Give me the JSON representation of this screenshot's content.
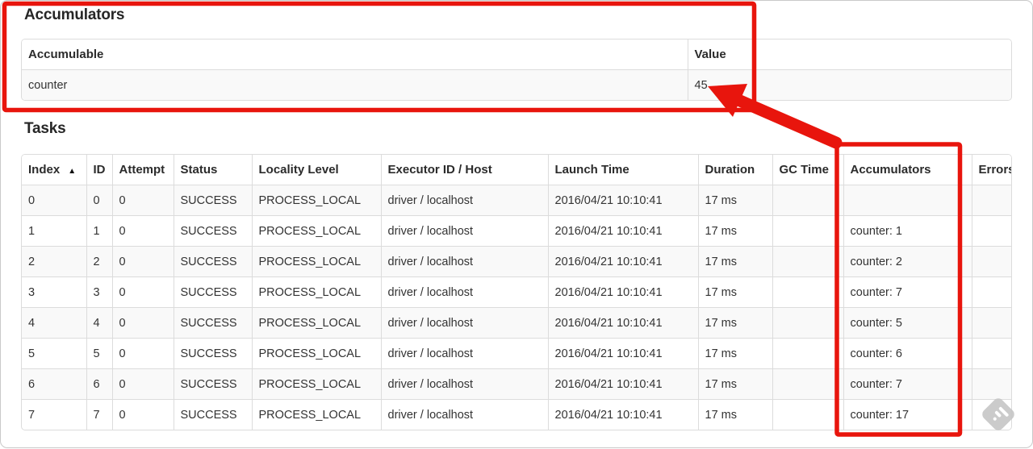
{
  "accumulators_section": {
    "title": "Accumulators",
    "table": {
      "col_accumulable": "Accumulable",
      "col_value": "Value",
      "row": {
        "accumulable": "counter",
        "value": "45"
      }
    }
  },
  "tasks_section": {
    "title": "Tasks",
    "table": {
      "headers": [
        "Index",
        "ID",
        "Attempt",
        "Status",
        "Locality Level",
        "Executor ID / Host",
        "Launch Time",
        "Duration",
        "GC Time",
        "Accumulators",
        "Errors"
      ],
      "sort_icon": "▲",
      "rows": [
        {
          "index": "0",
          "id": "0",
          "attempt": "0",
          "status": "SUCCESS",
          "locality_level": "PROCESS_LOCAL",
          "executor_id_host": "driver / localhost",
          "launch_time": "2016/04/21 10:10:41",
          "duration": "17 ms",
          "gc_time": "",
          "accumulators": "",
          "errors": ""
        },
        {
          "index": "1",
          "id": "1",
          "attempt": "0",
          "status": "SUCCESS",
          "locality_level": "PROCESS_LOCAL",
          "executor_id_host": "driver / localhost",
          "launch_time": "2016/04/21 10:10:41",
          "duration": "17 ms",
          "gc_time": "",
          "accumulators": "counter: 1",
          "errors": ""
        },
        {
          "index": "2",
          "id": "2",
          "attempt": "0",
          "status": "SUCCESS",
          "locality_level": "PROCESS_LOCAL",
          "executor_id_host": "driver / localhost",
          "launch_time": "2016/04/21 10:10:41",
          "duration": "17 ms",
          "gc_time": "",
          "accumulators": "counter: 2",
          "errors": ""
        },
        {
          "index": "3",
          "id": "3",
          "attempt": "0",
          "status": "SUCCESS",
          "locality_level": "PROCESS_LOCAL",
          "executor_id_host": "driver / localhost",
          "launch_time": "2016/04/21 10:10:41",
          "duration": "17 ms",
          "gc_time": "",
          "accumulators": "counter: 7",
          "errors": ""
        },
        {
          "index": "4",
          "id": "4",
          "attempt": "0",
          "status": "SUCCESS",
          "locality_level": "PROCESS_LOCAL",
          "executor_id_host": "driver / localhost",
          "launch_time": "2016/04/21 10:10:41",
          "duration": "17 ms",
          "gc_time": "",
          "accumulators": "counter: 5",
          "errors": ""
        },
        {
          "index": "5",
          "id": "5",
          "attempt": "0",
          "status": "SUCCESS",
          "locality_level": "PROCESS_LOCAL",
          "executor_id_host": "driver / localhost",
          "launch_time": "2016/04/21 10:10:41",
          "duration": "17 ms",
          "gc_time": "",
          "accumulators": "counter: 6",
          "errors": ""
        },
        {
          "index": "6",
          "id": "6",
          "attempt": "0",
          "status": "SUCCESS",
          "locality_level": "PROCESS_LOCAL",
          "executor_id_host": "driver / localhost",
          "launch_time": "2016/04/21 10:10:41",
          "duration": "17 ms",
          "gc_time": "",
          "accumulators": "counter: 7",
          "errors": ""
        },
        {
          "index": "7",
          "id": "7",
          "attempt": "0",
          "status": "SUCCESS",
          "locality_level": "PROCESS_LOCAL",
          "executor_id_host": "driver / localhost",
          "launch_time": "2016/04/21 10:10:41",
          "duration": "17 ms",
          "gc_time": "",
          "accumulators": "counter: 17",
          "errors": ""
        }
      ]
    }
  },
  "annotations": {
    "color": "#e8150d"
  },
  "watermark": {
    "color": "#c7c7c7"
  }
}
